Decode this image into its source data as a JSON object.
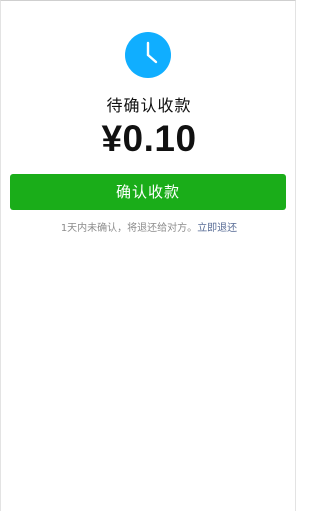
{
  "status": {
    "icon": "clock-icon",
    "title": "待确认收款"
  },
  "amount": {
    "display": "¥0.10"
  },
  "confirm_button": {
    "label": "确认收款"
  },
  "hint": {
    "text": "1天内未确认，将退还给对方。",
    "link_label": "立即退还"
  },
  "colors": {
    "accent_green": "#1aad19",
    "icon_blue": "#10aeff",
    "link_blue": "#576b95",
    "hint_gray": "#8c8c8c"
  }
}
